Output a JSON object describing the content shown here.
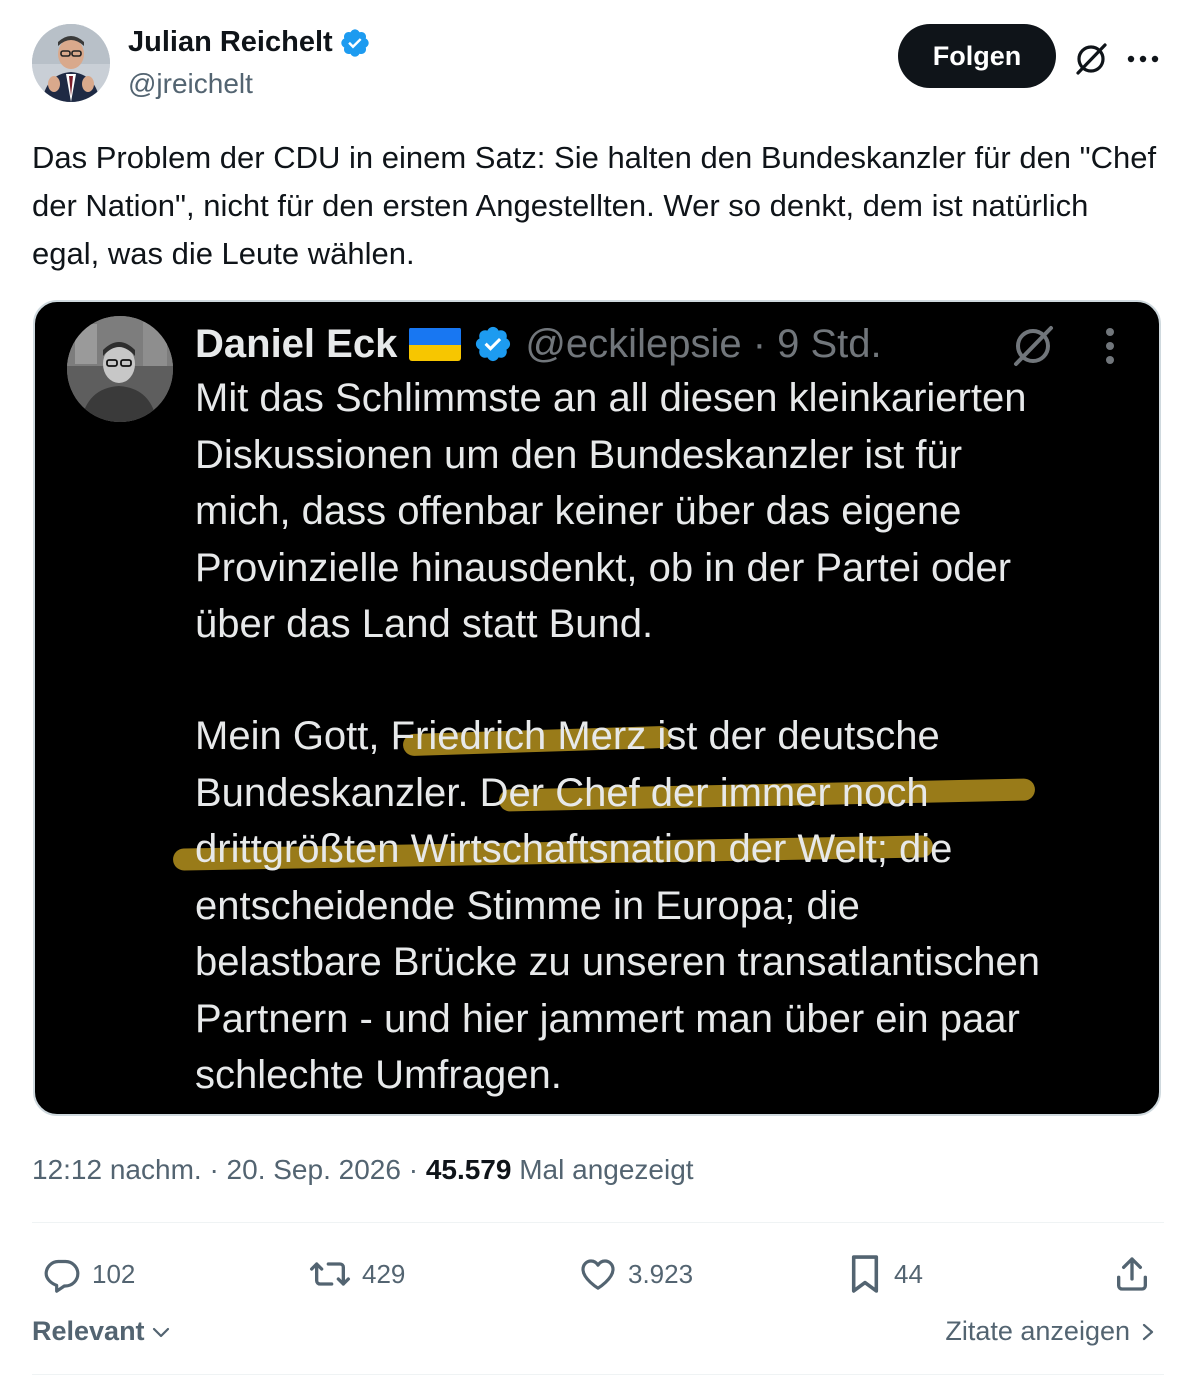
{
  "author": {
    "name": "Julian Reichelt",
    "handle": "@jreichelt"
  },
  "header": {
    "follow_label": "Folgen"
  },
  "tweet": {
    "text": "Das Problem der CDU in einem Satz: Sie halten den Bundeskanzler für den \"Chef der Nation\", nicht für den ersten Angestellten. Wer so denkt, dem ist natürlich egal, was die Leute wählen."
  },
  "quoted_screenshot": {
    "name": "Daniel Eck",
    "flag": "🇺🇦",
    "handle_time": "@eckilepsie · 9 Std.",
    "paragraph_1_lines": [
      "Mit das Schlimmste an all diesen kleinkarierten",
      "Diskussionen um den Bundeskanzler ist für",
      "mich, dass offenbar keiner über das eigene",
      "Provinzielle hinausdenkt, ob in der Partei oder",
      "über das Land statt Bund."
    ],
    "paragraph_2_lines": [
      "Mein Gott, Friedrich Merz ist der deutsche",
      "Bundeskanzler. Der Chef der immer noch",
      "drittgrößten Wirtschaftsnation der Welt; die",
      "entscheidende Stimme in Europa; die",
      "belastbare Brücke zu unseren transatlantischen",
      "Partnern - und hier jammert man über ein paar",
      "schlechte Umfragen."
    ]
  },
  "meta": {
    "time_date": "12:12 nachm. · 20. Sep. 2026 · ",
    "views_count": "45.579",
    "views_label": " Mal angezeigt"
  },
  "actions": {
    "replies": "102",
    "reposts": "429",
    "likes": "3.923",
    "bookmarks": "44"
  },
  "footer": {
    "sort_label": "Relevant",
    "quotes_label": "Zitate anzeigen"
  },
  "colors": {
    "verified": "#1d9bf0",
    "text_secondary": "#536471",
    "highlight": "#c49e20"
  },
  "icons": [
    "verified-badge-icon",
    "grok-icon",
    "more-icon",
    "reply-icon",
    "repost-icon",
    "like-icon",
    "bookmark-icon",
    "share-icon",
    "chevron-down-icon",
    "chevron-right-icon"
  ]
}
